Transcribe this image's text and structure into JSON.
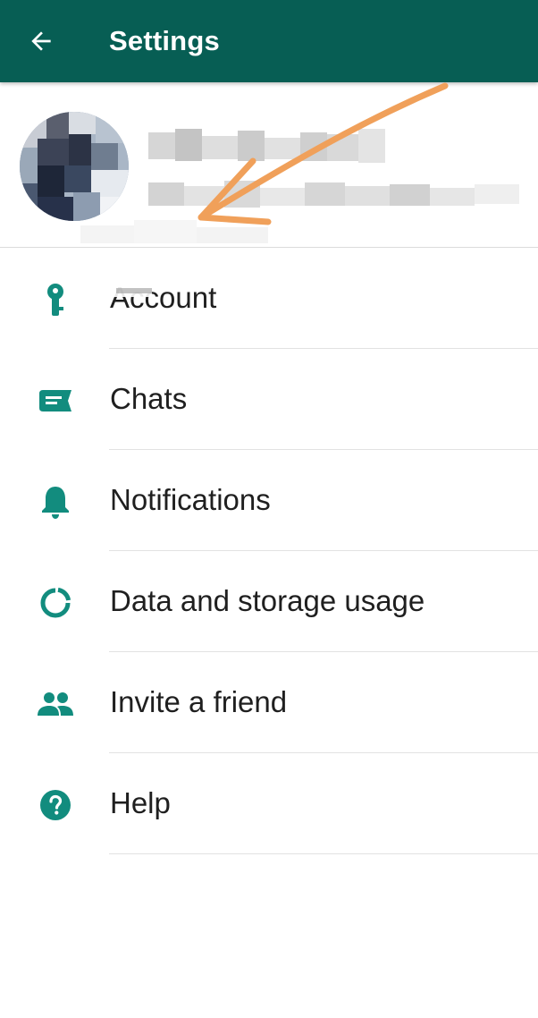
{
  "header": {
    "title": "Settings",
    "back_icon": "arrow-left-icon",
    "background_color": "#075e54"
  },
  "profile": {
    "avatar_icon": "profile-photo"
  },
  "menu": {
    "accent_color": "#128c7e",
    "items": [
      {
        "label": "Account",
        "icon": "key-icon"
      },
      {
        "label": "Chats",
        "icon": "chat-icon"
      },
      {
        "label": "Notifications",
        "icon": "bell-icon"
      },
      {
        "label": "Data and storage usage",
        "icon": "data-usage-icon"
      },
      {
        "label": "Invite a friend",
        "icon": "people-icon"
      },
      {
        "label": "Help",
        "icon": "help-icon"
      }
    ]
  },
  "annotation": {
    "arrow_color": "#f0a05a"
  }
}
